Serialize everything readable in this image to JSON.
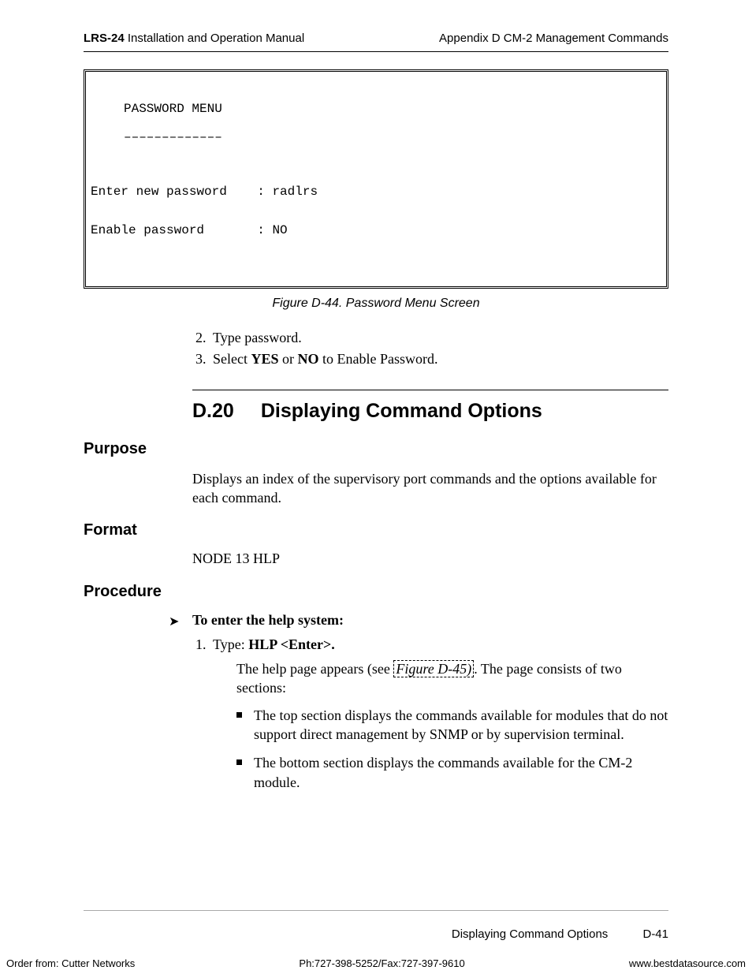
{
  "header": {
    "left_bold": "LRS-24",
    "left_rest": " Installation and Operation Manual",
    "right": "Appendix D  CM-2 Management Commands"
  },
  "screenbox": {
    "title": "PASSWORD MENU",
    "dashes": "–––––––––––––",
    "row1_label": "Enter new password",
    "row1_value": ": radlrs",
    "row2_label": "Enable password",
    "row2_value": ": NO"
  },
  "fig44_caption": "Figure D-44.  Password Menu Screen",
  "steps_above": {
    "s2": "Type password.",
    "s3_a": "Select ",
    "s3_yes": "YES",
    "s3_or": " or ",
    "s3_no": "NO",
    "s3_b": " to Enable Password."
  },
  "section": {
    "num": "D.20",
    "title": "Displaying Command Options"
  },
  "purpose": {
    "heading": "Purpose",
    "text": "Displays an index of the supervisory port commands and the options available for each command."
  },
  "format": {
    "heading": "Format",
    "text": "NODE 13 HLP"
  },
  "procedure": {
    "heading": "Procedure",
    "arrow": "➤",
    "lead": "To enter the help system:",
    "step1_prefix": "Type: ",
    "step1_bold": "HLP <Enter>.",
    "sub_a": "The help page appears (see ",
    "fig_ref": "Figure D-45)",
    "sub_b": ". The page consists of two sections:",
    "bullet1": "The top section displays the commands available for modules that do not support direct management by SNMP or by supervision terminal.",
    "bullet2": "The bottom section displays the commands available for the CM-2 module."
  },
  "footer": {
    "running_title": "Displaying Command Options",
    "page_num": "D-41",
    "order": "Order from: Cutter Networks",
    "phone": "Ph:727-398-5252/Fax:727-397-9610",
    "site": "www.bestdatasource.com"
  }
}
